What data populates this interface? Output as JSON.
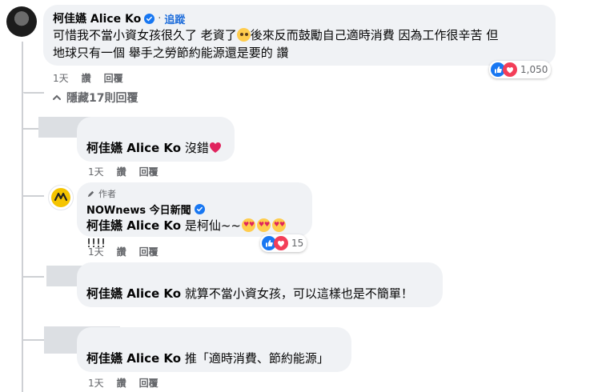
{
  "main_comment": {
    "name": "柯佳嬿 Alice Ko",
    "follow": "追蹤",
    "separator": "·",
    "text_line1a": "可惜我不當小資女孩很久了 老資了",
    "text_line1b": "後來反而鼓勵自己適時消費 因為工作很辛苦 但",
    "text_line2": "地球只有一個 舉手之勞節約能源還是要的 讚",
    "time": "1天",
    "like": "讚",
    "reply": "回覆",
    "reaction_count": "1,050"
  },
  "hidden_replies": {
    "label": "隱藏17則回覆"
  },
  "replies": [
    {
      "name": "柯佳嬿 Alice Ko",
      "text": "沒錯",
      "time": "1天",
      "like": "讚",
      "reply": "回覆"
    },
    {
      "author_tag": "作者",
      "name": "NOWnews 今日新聞",
      "text_a": "柯佳嬿 Alice Ko",
      "text_b": "是柯仙~~",
      "text_c": "!!!!",
      "time": "1天",
      "like": "讚",
      "reply": "回覆",
      "reaction_count": "15"
    },
    {
      "name": "柯佳嬿 Alice Ko",
      "text": "就算不當小資女孩，可以這樣也是不簡單！"
    },
    {
      "name": "柯佳嬿 Alice Ko",
      "text": "推「適時消費、節約能源」",
      "time": "1天",
      "like": "讚",
      "reply": "回覆"
    }
  ],
  "icons": {
    "verified": "verified-badge-icon",
    "like": "like-reaction-icon",
    "love": "love-reaction-icon",
    "heart": "red-heart-emoji",
    "pencil": "pencil-icon",
    "chevron": "chevron-up-icon"
  },
  "colors": {
    "facebook_blue": "#216fdb",
    "bubble_bg": "#f0f2f5",
    "meta_text": "#65676b",
    "love_red": "#f33e58"
  }
}
